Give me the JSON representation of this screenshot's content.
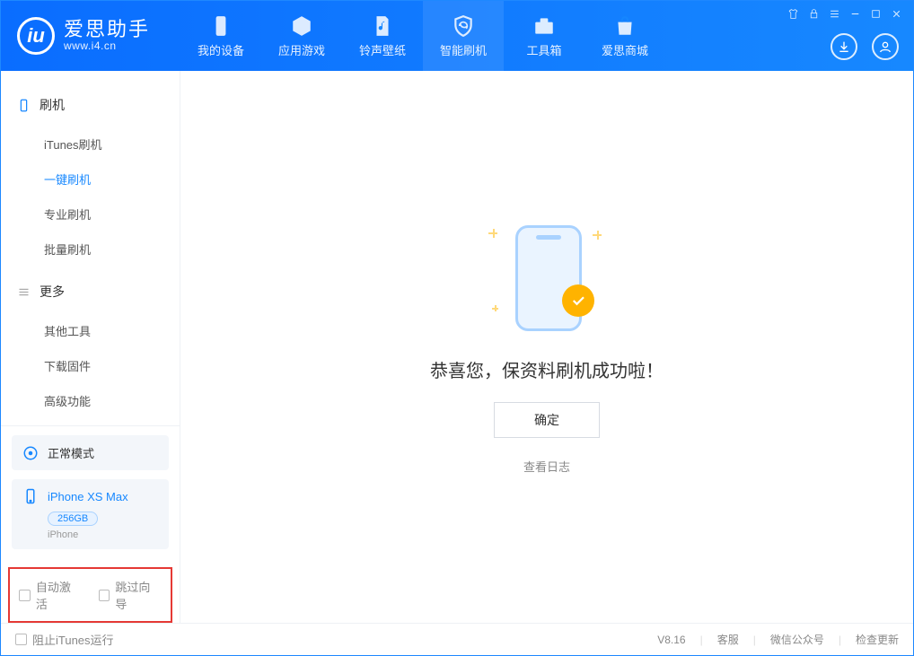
{
  "app": {
    "name_cn": "爱思助手",
    "name_en": "www.i4.cn"
  },
  "nav": {
    "device": "我的设备",
    "apps": "应用游戏",
    "ringtones": "铃声壁纸",
    "flash": "智能刷机",
    "tools": "工具箱",
    "store": "爱思商城"
  },
  "sidebar": {
    "flash_head": "刷机",
    "items": {
      "itunes": "iTunes刷机",
      "oneclick": "一键刷机",
      "pro": "专业刷机",
      "batch": "批量刷机"
    },
    "more_head": "更多",
    "more": {
      "other": "其他工具",
      "firmware": "下载固件",
      "advanced": "高级功能"
    }
  },
  "device": {
    "mode": "正常模式",
    "name": "iPhone XS Max",
    "capacity": "256GB",
    "type": "iPhone"
  },
  "options": {
    "auto_activate": "自动激活",
    "skip_guide": "跳过向导"
  },
  "result": {
    "message": "恭喜您，保资料刷机成功啦！",
    "confirm": "确定",
    "view_log": "查看日志"
  },
  "footer": {
    "block_itunes": "阻止iTunes运行",
    "version": "V8.16",
    "support": "客服",
    "wechat": "微信公众号",
    "update": "检查更新"
  }
}
